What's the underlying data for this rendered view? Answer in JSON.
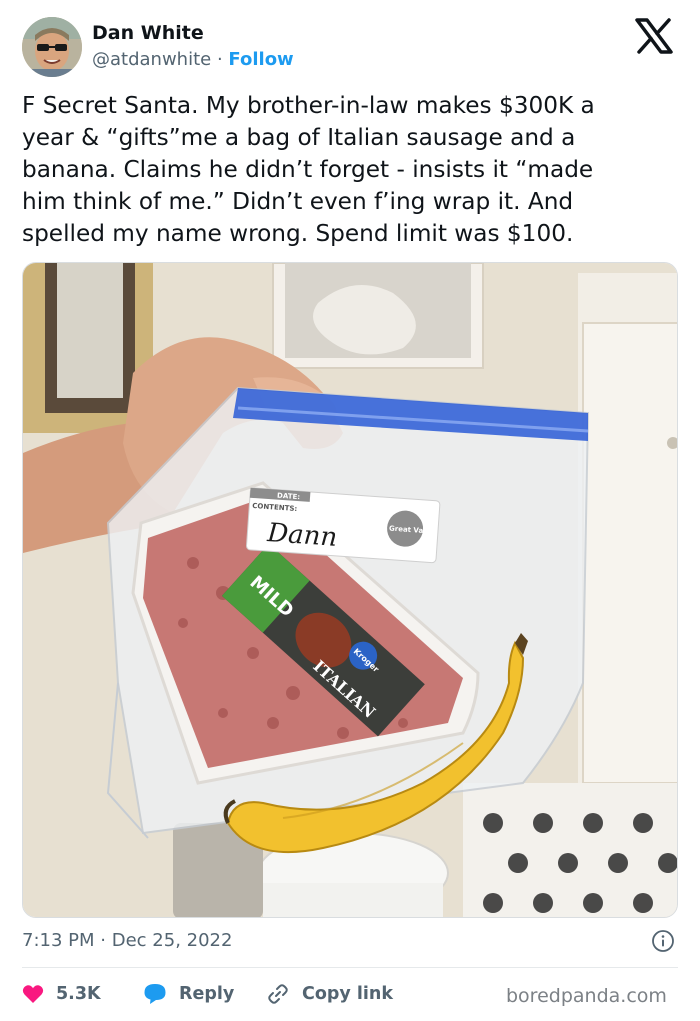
{
  "author": {
    "name": "Dan White",
    "handle": "@atdanwhite",
    "separator": "·",
    "follow_label": "Follow"
  },
  "tweet": {
    "lines": [
      "F Secret Santa. My brother-in-law makes $300K a",
      "year & “gifts”me a bag of Italian sausage and a",
      "banana. Claims he didn’t forget - insists it “made",
      "him think of me.” Didn’t even f’ing wrap it. And",
      "spelled my name wrong. Spend limit was $100."
    ]
  },
  "photo": {
    "label_date": "DATE:",
    "label_contents": "CONTENTS:",
    "label_name": "Dann",
    "brand_badge": "Great Value",
    "package_mild": "MILD",
    "package_italian": "ITALIAN",
    "package_brand": "Kroger"
  },
  "meta": {
    "time": "7:13 PM",
    "separator": "·",
    "date": "Dec 25, 2022"
  },
  "actions": {
    "likes": "5.3K",
    "reply_label": "Reply",
    "copy_link_label": "Copy link"
  },
  "watermark": "boredpanda.com",
  "colors": {
    "text": "#0f1419",
    "secondary": "#536471",
    "accent": "#1d9bf0",
    "like": "#f91880",
    "banana": "#f2c12e",
    "bag_zip": "#2a5bd6"
  }
}
